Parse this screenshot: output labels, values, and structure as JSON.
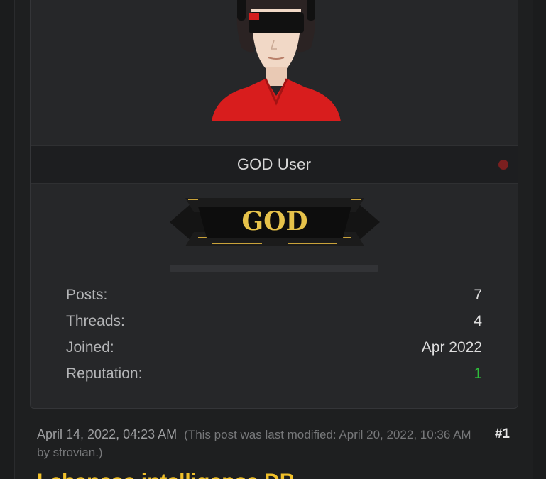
{
  "user_card": {
    "username": "GOD User",
    "status": "offline",
    "rank_badge_text": "GOD",
    "stats": [
      {
        "label": "Posts:",
        "value": "7"
      },
      {
        "label": "Threads:",
        "value": "4"
      },
      {
        "label": "Joined:",
        "value": "Apr 2022"
      },
      {
        "label": "Reputation:",
        "value": "1"
      }
    ]
  },
  "post": {
    "date": "April 14, 2022, 04:23 AM",
    "modified_note": "(This post was last modified: April 20, 2022, 10:36 AM by strovian.)",
    "number": "#1",
    "title": "Lebanese intelligence DB"
  },
  "colors": {
    "accent_gold": "#f0c02a",
    "reputation_green": "#2fbf3b",
    "status_offline": "#7a1f1f"
  }
}
